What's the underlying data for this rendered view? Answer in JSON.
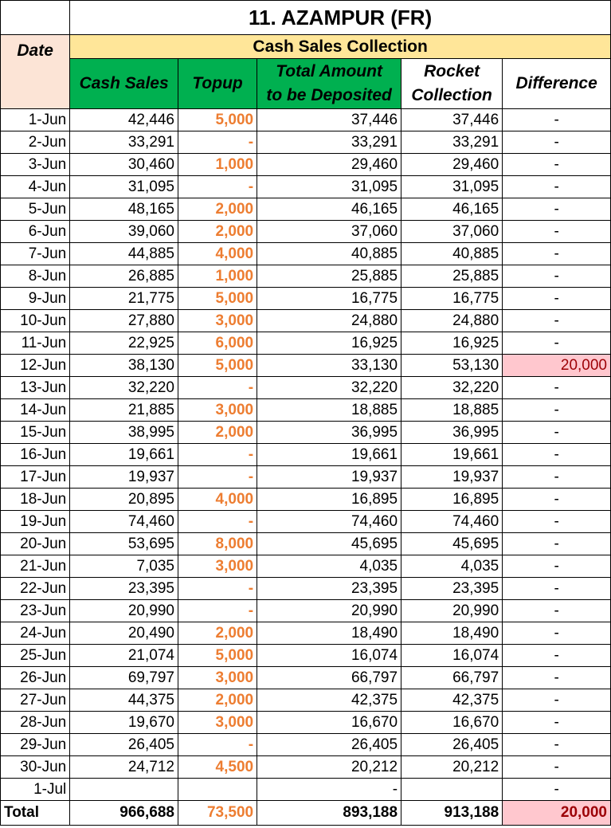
{
  "title": "11. AZAMPUR (FR)",
  "section_label": "Cash Sales Collection",
  "columns": {
    "date": "Date",
    "cash_sales": "Cash Sales",
    "topup": "Topup",
    "total_line1": "Total Amount",
    "total_line2": "to be Deposited",
    "rocket_line1": "Rocket",
    "rocket_line2": "Collection",
    "difference": "Difference"
  },
  "rows": [
    {
      "date": "1-Jun",
      "cash": "42,446",
      "topup": "5,000",
      "total": "37,446",
      "rocket": "37,446",
      "diff": "-"
    },
    {
      "date": "2-Jun",
      "cash": "33,291",
      "topup": "-",
      "total": "33,291",
      "rocket": "33,291",
      "diff": "-"
    },
    {
      "date": "3-Jun",
      "cash": "30,460",
      "topup": "1,000",
      "total": "29,460",
      "rocket": "29,460",
      "diff": "-"
    },
    {
      "date": "4-Jun",
      "cash": "31,095",
      "topup": "-",
      "total": "31,095",
      "rocket": "31,095",
      "diff": "-"
    },
    {
      "date": "5-Jun",
      "cash": "48,165",
      "topup": "2,000",
      "total": "46,165",
      "rocket": "46,165",
      "diff": "-"
    },
    {
      "date": "6-Jun",
      "cash": "39,060",
      "topup": "2,000",
      "total": "37,060",
      "rocket": "37,060",
      "diff": "-"
    },
    {
      "date": "7-Jun",
      "cash": "44,885",
      "topup": "4,000",
      "total": "40,885",
      "rocket": "40,885",
      "diff": "-"
    },
    {
      "date": "8-Jun",
      "cash": "26,885",
      "topup": "1,000",
      "total": "25,885",
      "rocket": "25,885",
      "diff": "-"
    },
    {
      "date": "9-Jun",
      "cash": "21,775",
      "topup": "5,000",
      "total": "16,775",
      "rocket": "16,775",
      "diff": "-"
    },
    {
      "date": "10-Jun",
      "cash": "27,880",
      "topup": "3,000",
      "total": "24,880",
      "rocket": "24,880",
      "diff": "-"
    },
    {
      "date": "11-Jun",
      "cash": "22,925",
      "topup": "6,000",
      "total": "16,925",
      "rocket": "16,925",
      "diff": "-"
    },
    {
      "date": "12-Jun",
      "cash": "38,130",
      "topup": "5,000",
      "total": "33,130",
      "rocket": "53,130",
      "diff": "20,000"
    },
    {
      "date": "13-Jun",
      "cash": "32,220",
      "topup": "-",
      "total": "32,220",
      "rocket": "32,220",
      "diff": "-"
    },
    {
      "date": "14-Jun",
      "cash": "21,885",
      "topup": "3,000",
      "total": "18,885",
      "rocket": "18,885",
      "diff": "-"
    },
    {
      "date": "15-Jun",
      "cash": "38,995",
      "topup": "2,000",
      "total": "36,995",
      "rocket": "36,995",
      "diff": "-"
    },
    {
      "date": "16-Jun",
      "cash": "19,661",
      "topup": "-",
      "total": "19,661",
      "rocket": "19,661",
      "diff": "-"
    },
    {
      "date": "17-Jun",
      "cash": "19,937",
      "topup": "-",
      "total": "19,937",
      "rocket": "19,937",
      "diff": "-"
    },
    {
      "date": "18-Jun",
      "cash": "20,895",
      "topup": "4,000",
      "total": "16,895",
      "rocket": "16,895",
      "diff": "-"
    },
    {
      "date": "19-Jun",
      "cash": "74,460",
      "topup": "-",
      "total": "74,460",
      "rocket": "74,460",
      "diff": "-"
    },
    {
      "date": "20-Jun",
      "cash": "53,695",
      "topup": "8,000",
      "total": "45,695",
      "rocket": "45,695",
      "diff": "-"
    },
    {
      "date": "21-Jun",
      "cash": "7,035",
      "topup": "3,000",
      "total": "4,035",
      "rocket": "4,035",
      "diff": "-"
    },
    {
      "date": "22-Jun",
      "cash": "23,395",
      "topup": "-",
      "total": "23,395",
      "rocket": "23,395",
      "diff": "-"
    },
    {
      "date": "23-Jun",
      "cash": "20,990",
      "topup": "-",
      "total": "20,990",
      "rocket": "20,990",
      "diff": "-"
    },
    {
      "date": "24-Jun",
      "cash": "20,490",
      "topup": "2,000",
      "total": "18,490",
      "rocket": "18,490",
      "diff": "-"
    },
    {
      "date": "25-Jun",
      "cash": "21,074",
      "topup": "5,000",
      "total": "16,074",
      "rocket": "16,074",
      "diff": "-"
    },
    {
      "date": "26-Jun",
      "cash": "69,797",
      "topup": "3,000",
      "total": "66,797",
      "rocket": "66,797",
      "diff": "-"
    },
    {
      "date": "27-Jun",
      "cash": "44,375",
      "topup": "2,000",
      "total": "42,375",
      "rocket": "42,375",
      "diff": "-"
    },
    {
      "date": "28-Jun",
      "cash": "19,670",
      "topup": "3,000",
      "total": "16,670",
      "rocket": "16,670",
      "diff": "-"
    },
    {
      "date": "29-Jun",
      "cash": "26,405",
      "topup": "-",
      "total": "26,405",
      "rocket": "26,405",
      "diff": "-"
    },
    {
      "date": "30-Jun",
      "cash": "24,712",
      "topup": "4,500",
      "total": "20,212",
      "rocket": "20,212",
      "diff": "-"
    },
    {
      "date": "1-Jul",
      "cash": "",
      "topup": "",
      "total": "-",
      "rocket": "",
      "diff": "-"
    }
  ],
  "totals": {
    "label": "Total",
    "cash": "966,688",
    "topup": "73,500",
    "total": "893,188",
    "rocket": "913,188",
    "diff": "20,000"
  },
  "colors": {
    "header_green": "#00B050",
    "section_yellow": "#FFE699",
    "date_header_peach": "#FCE4D6",
    "topup_orange": "#ED7D31",
    "difference_fill": "#FFC7CE",
    "difference_text": "#9C0006"
  }
}
